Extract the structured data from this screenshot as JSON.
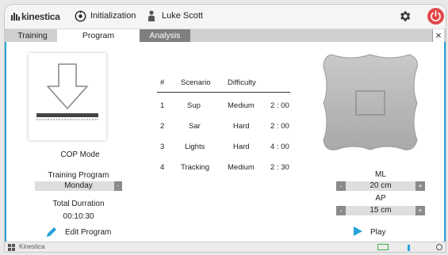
{
  "header": {
    "brand": "kinestica",
    "mode": "Initialization",
    "user": "Luke Scott"
  },
  "tabs": [
    "Training",
    "Program",
    "Analysis"
  ],
  "active_tab": "Program",
  "left_panel": {
    "mode_label": "COP Mode",
    "training_program_label": "Training Program",
    "training_program_value": "Monday",
    "total_duration_label": "Total Durration",
    "total_duration_value": "00:10:30",
    "edit_label": "Edit Program"
  },
  "table": {
    "headers": [
      "#",
      "Scenario",
      "Difficulty",
      ""
    ],
    "rows": [
      [
        "1",
        "Sup",
        "Medium",
        "2 : 00"
      ],
      [
        "2",
        "Sar",
        "Hard",
        "2 : 00"
      ],
      [
        "3",
        "Lights",
        "Hard",
        "4 : 00"
      ],
      [
        "4",
        "Tracking",
        "Medium",
        "2 : 30"
      ]
    ]
  },
  "right_panel": {
    "ml_label": "ML",
    "ml_value": "20 cm",
    "ap_label": "AP",
    "ap_value": "15 cm",
    "minus": "-",
    "plus": "+",
    "play_label": "Play"
  },
  "statusbar": {
    "app_name": "Kinestica"
  },
  "colors": {
    "accent": "#29a3d9",
    "power": "#e04848",
    "tab_dark": "#7f7f7f"
  }
}
